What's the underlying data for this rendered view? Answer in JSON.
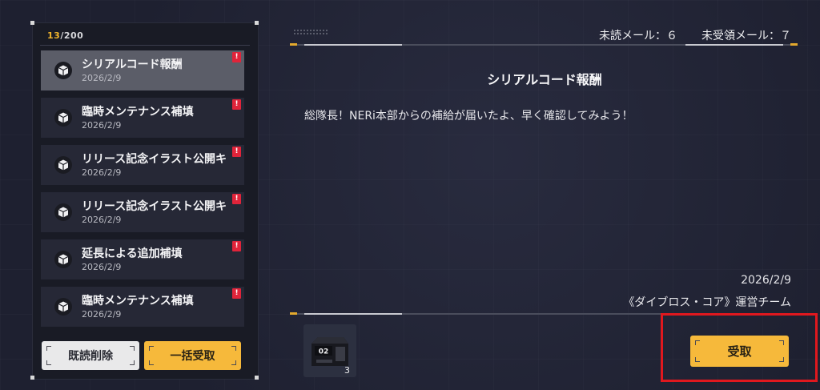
{
  "mail_counter": {
    "current": "13",
    "separator": "/",
    "total": "200"
  },
  "mail_list": [
    {
      "title": "シリアルコード報酬",
      "date": "2026/2/9",
      "unread_mark": "!",
      "selected": true,
      "icon": "package-icon"
    },
    {
      "title": "臨時メンテナンス補填",
      "date": "2026/2/9",
      "unread_mark": "!",
      "selected": false,
      "icon": "package-icon"
    },
    {
      "title": "リリース記念イラスト公開キ",
      "date": "2026/2/9",
      "unread_mark": "!",
      "selected": false,
      "icon": "package-icon"
    },
    {
      "title": "リリース記念イラスト公開キ",
      "date": "2026/2/9",
      "unread_mark": "!",
      "selected": false,
      "icon": "package-icon"
    },
    {
      "title": "延長による追加補填",
      "date": "2026/2/9",
      "unread_mark": "!",
      "selected": false,
      "icon": "package-icon"
    },
    {
      "title": "臨時メンテナンス補填",
      "date": "2026/2/9",
      "unread_mark": "!",
      "selected": false,
      "icon": "package-icon"
    }
  ],
  "buttons": {
    "read_delete": "既読削除",
    "claim_all": "一括受取",
    "claim": "受取"
  },
  "stats": {
    "unread": "未読メール：６",
    "unclaimed": "未受領メール：７"
  },
  "mail_detail": {
    "subject": "シリアルコード報酬",
    "body": "総隊長！NERi本部からの補給が届いたよ、早く確認してみよう！",
    "date": "2026/2/9",
    "sender": "《ダイブロス・コア》運営チーム"
  },
  "reward": {
    "label": "02",
    "quantity": "3",
    "icon": "supply-crate-icon"
  },
  "colors": {
    "accent": "#f6b93b",
    "badge": "#e0243a",
    "highlight": "#e0181e"
  }
}
